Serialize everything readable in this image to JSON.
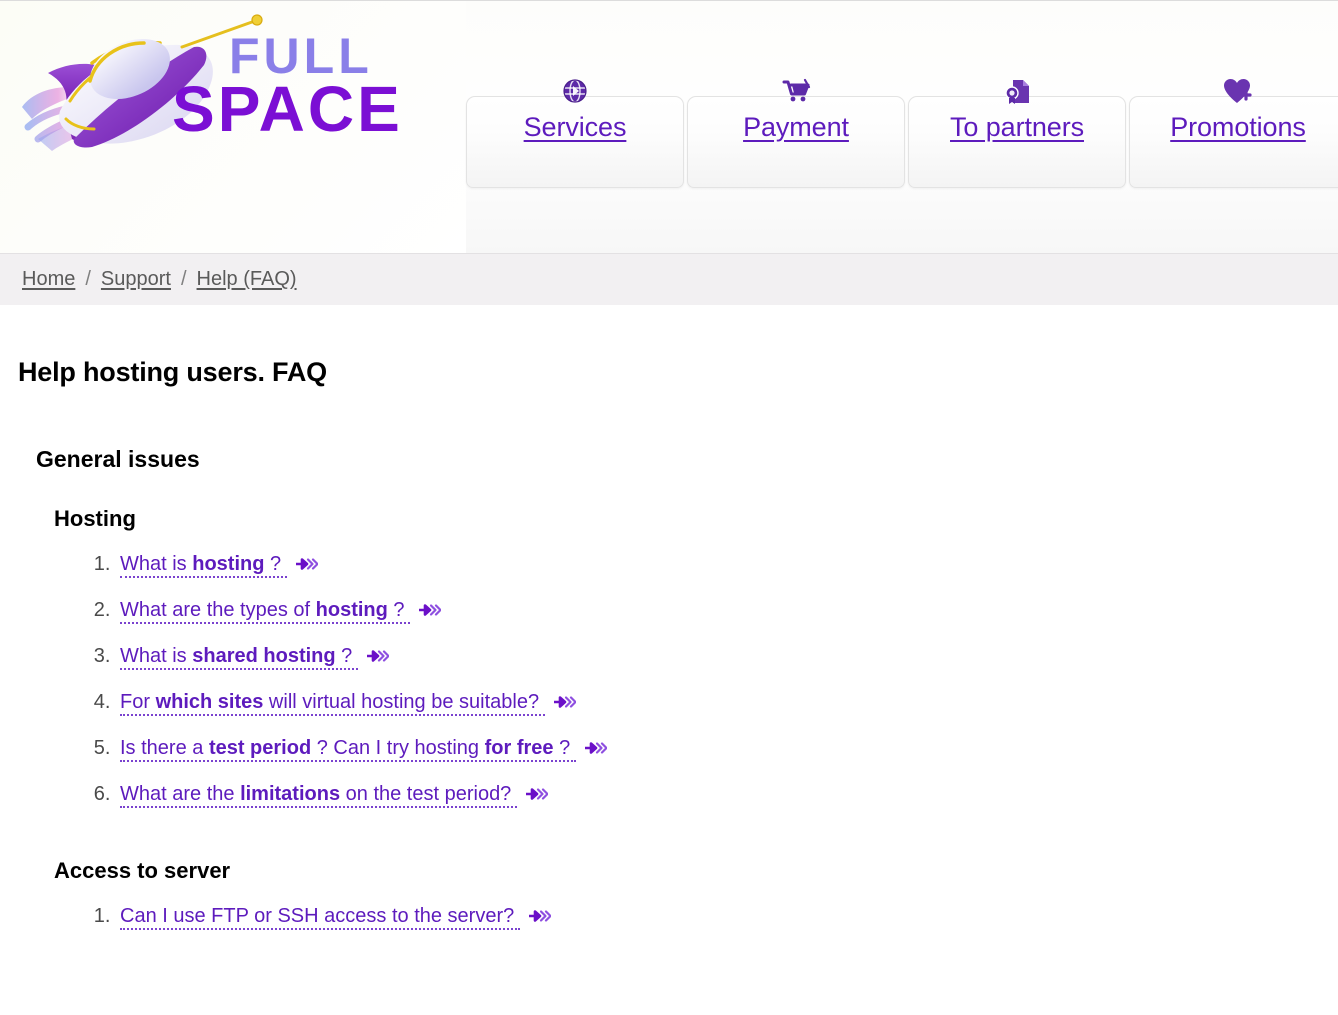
{
  "site": {
    "logo_text_top": "FULL",
    "logo_text_bottom": "SPACE",
    "logo_icon": "rocket-ufo-logo",
    "brand_purple": "#7b0fd4",
    "brand_light_purple": "#8a7fe8",
    "link_purple": "#5d1bbd"
  },
  "nav": {
    "tabs": [
      {
        "label": "Services",
        "icon": "globe-network-icon"
      },
      {
        "label": "Payment",
        "icon": "shopping-cart-icon"
      },
      {
        "label": "To partners",
        "icon": "document-award-icon"
      },
      {
        "label": "Promotions",
        "icon": "heart-plus-icon"
      }
    ]
  },
  "breadcrumb": {
    "separator": "/",
    "items": [
      {
        "label": "Home"
      },
      {
        "label": "Support"
      },
      {
        "label": "Help (FAQ)"
      }
    ]
  },
  "main": {
    "page_title": "Help hosting users. FAQ",
    "sections": [
      {
        "title": "General issues",
        "subsections": [
          {
            "title": "Hosting",
            "items": [
              {
                "pre": "What is ",
                "strong": "hosting",
                "post": " ?"
              },
              {
                "pre": "What are the types of ",
                "strong": "hosting",
                "post": " ?"
              },
              {
                "pre": "What is ",
                "strong": "shared hosting",
                "post": " ?"
              },
              {
                "pre": "For ",
                "strong": "which sites",
                "post": " will virtual hosting be suitable?"
              },
              {
                "pre": "Is there a ",
                "strong": "test period",
                "mid": " ? Can I try hosting ",
                "strong2": "for free",
                "post": " ?"
              },
              {
                "pre": "What are the ",
                "strong": "limitations",
                "post": " on the test period?"
              }
            ]
          },
          {
            "title": "Access to server",
            "items": [
              {
                "pre": "Can I use FTP or SSH access to the server?",
                "strong": "",
                "post": ""
              }
            ]
          }
        ]
      }
    ],
    "arrow_icon": "arrow-double-chevron-icon"
  }
}
